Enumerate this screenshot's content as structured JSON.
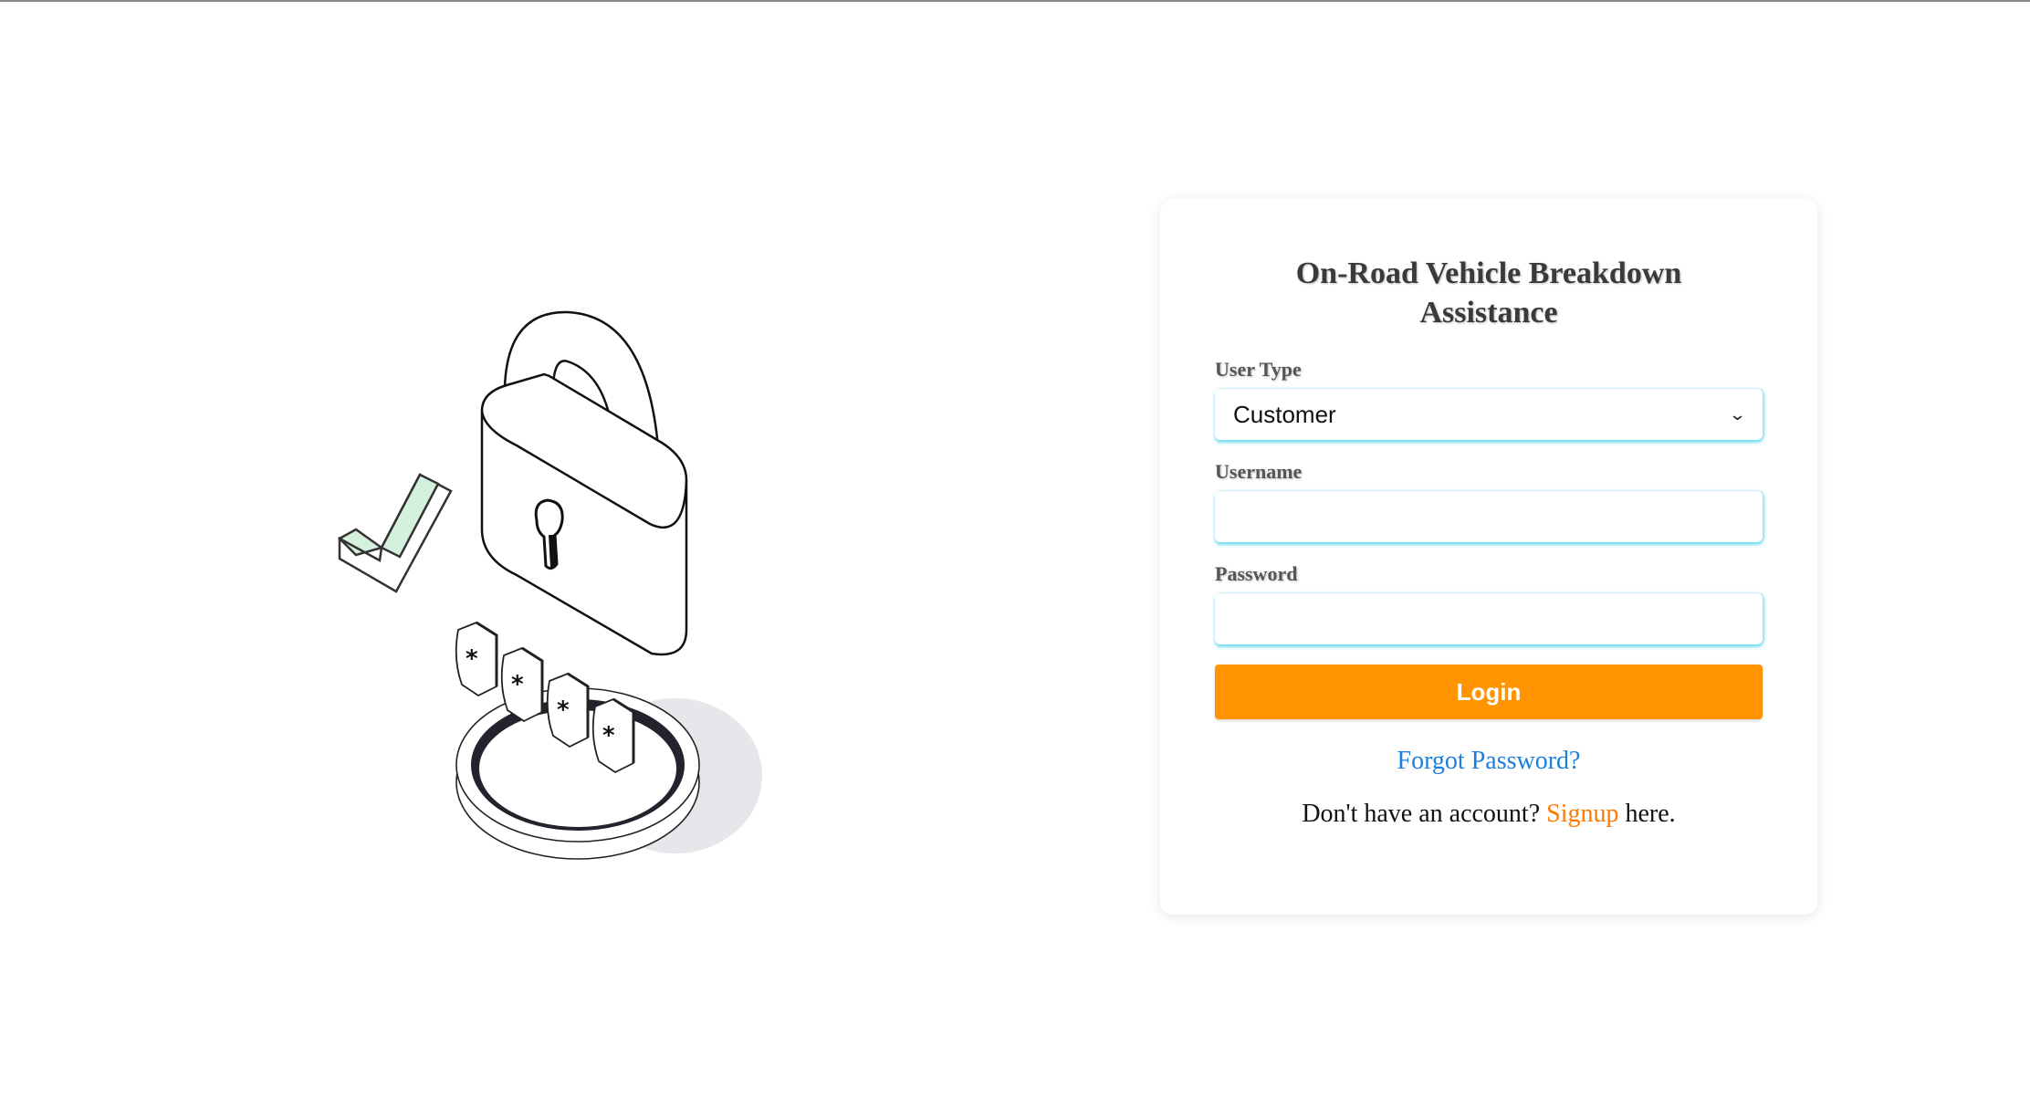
{
  "title": "On-Road Vehicle Breakdown Assistance",
  "form": {
    "user_type_label": "User Type",
    "user_type_value": "Customer",
    "username_label": "Username",
    "username_value": "",
    "password_label": "Password",
    "password_value": "",
    "login_label": "Login"
  },
  "links": {
    "forgot_password": "Forgot Password?",
    "signup_prefix": "Don't have an account? ",
    "signup_label": "Signup",
    "signup_suffix": " here."
  },
  "illustration": {
    "password_chars": [
      "*",
      "*",
      "*",
      "*"
    ],
    "icons": [
      "padlock-icon",
      "checkmark-icon",
      "keyhole-icon"
    ]
  },
  "colors": {
    "accent_orange": "#ff9400",
    "link_blue": "#1a7fe0",
    "signup_orange": "#ff7a00",
    "input_glow": "#50d2f0",
    "check_fill": "#d3f1dc"
  }
}
